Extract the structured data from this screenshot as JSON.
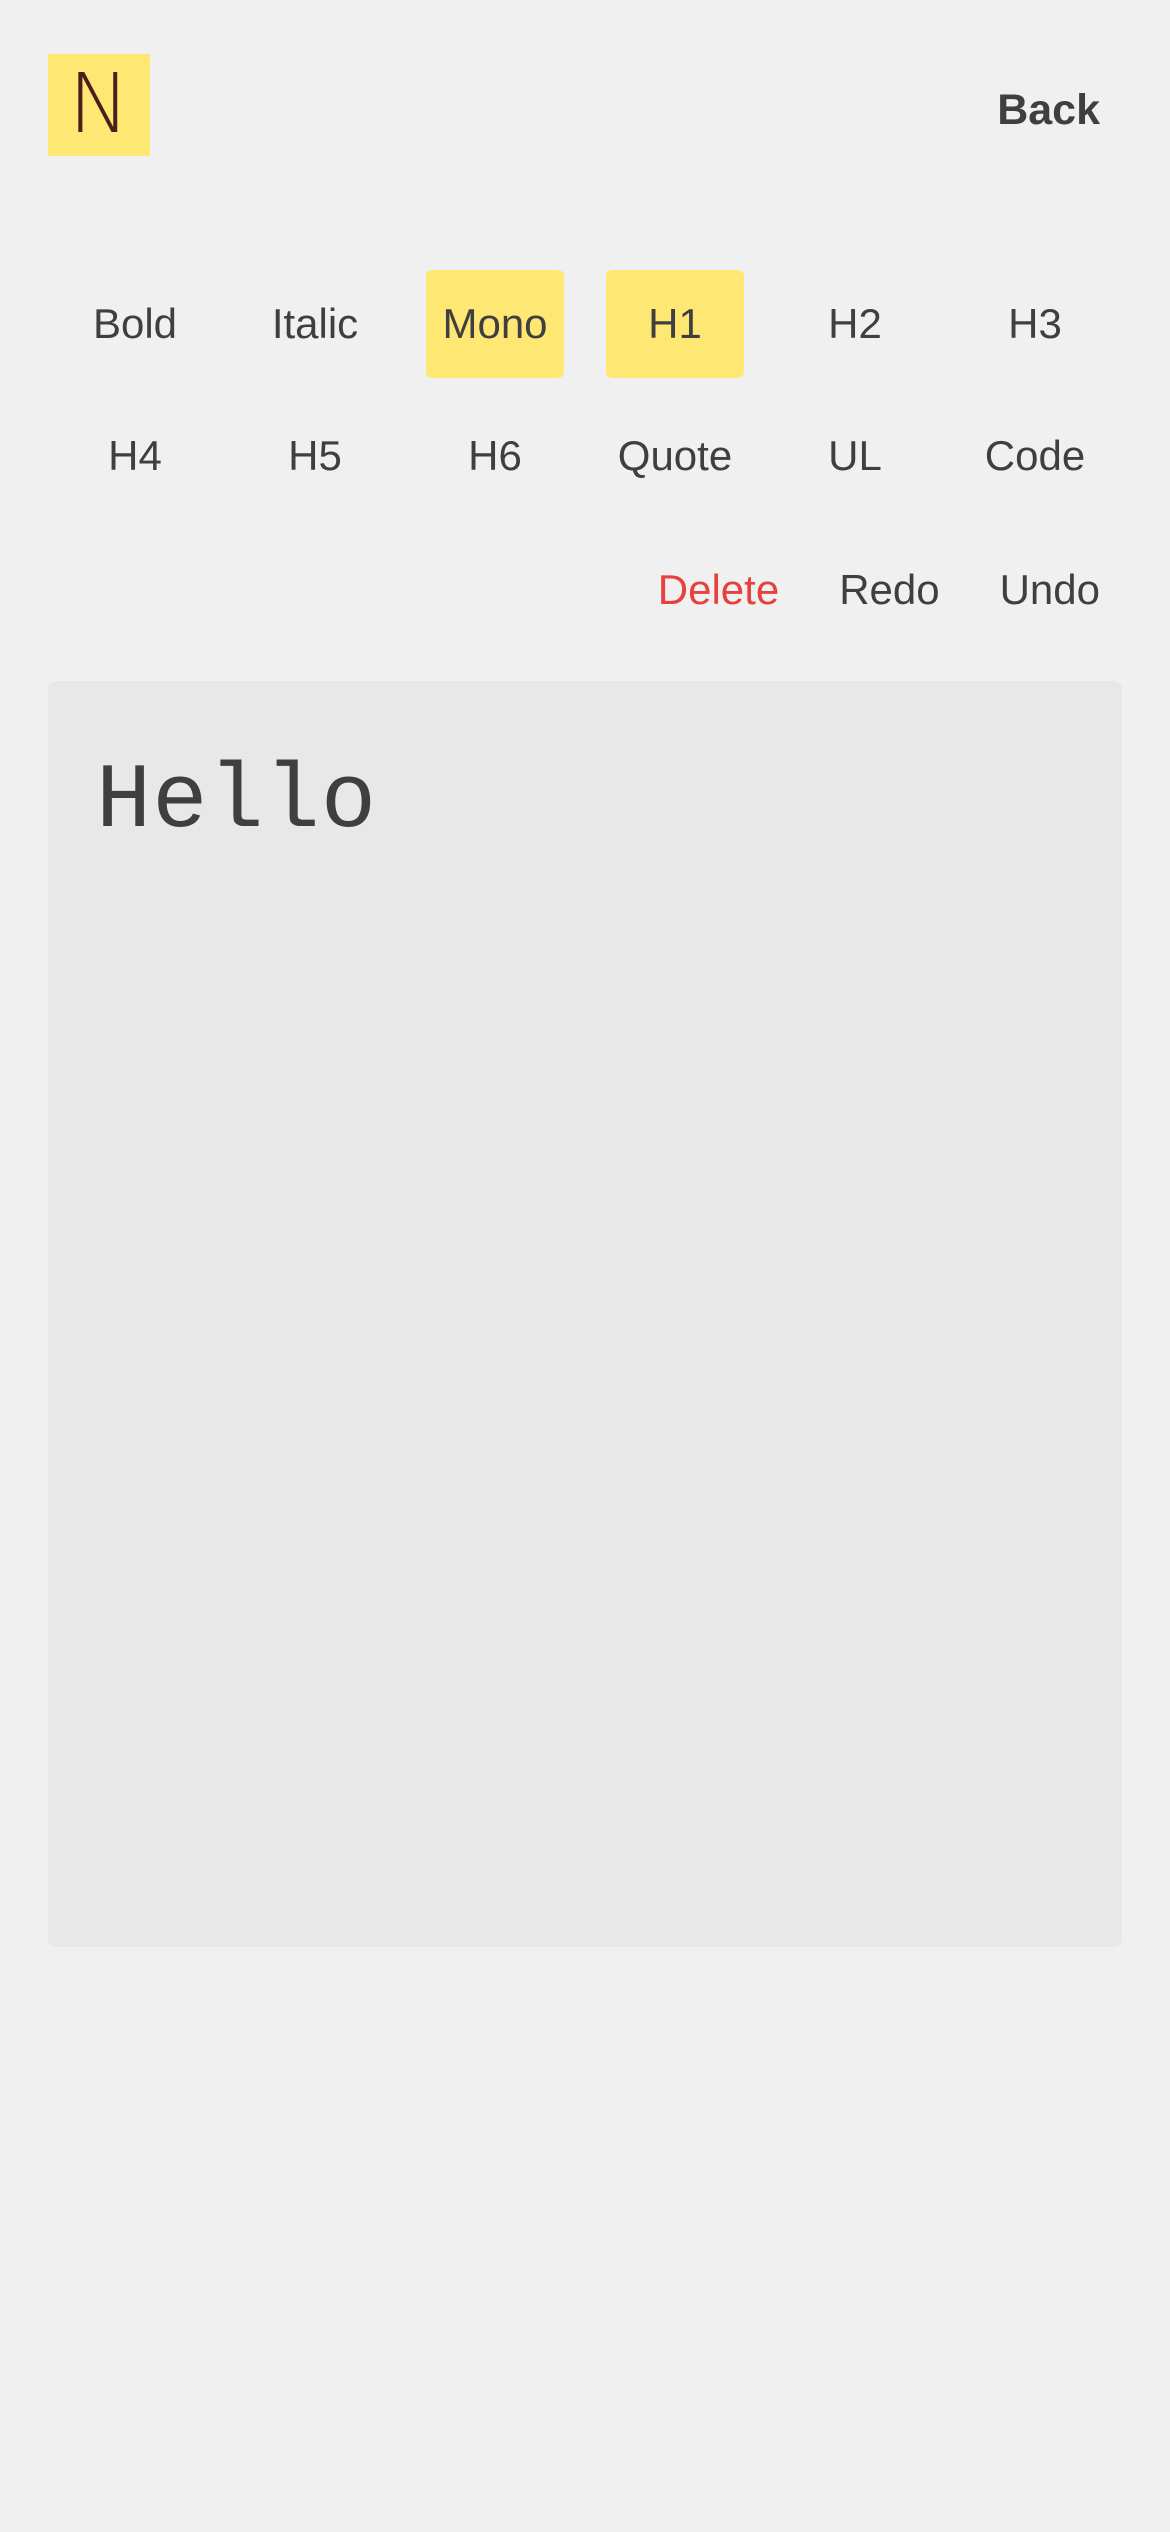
{
  "header": {
    "logo_letter": "N",
    "back_label": "Back"
  },
  "toolbar": {
    "rows": [
      [
        {
          "label": "Bold",
          "active": false
        },
        {
          "label": "Italic",
          "active": false
        },
        {
          "label": "Mono",
          "active": true
        },
        {
          "label": "H1",
          "active": true
        },
        {
          "label": "H2",
          "active": false
        },
        {
          "label": "H3",
          "active": false
        }
      ],
      [
        {
          "label": "H4",
          "active": false
        },
        {
          "label": "H5",
          "active": false
        },
        {
          "label": "H6",
          "active": false
        },
        {
          "label": "Quote",
          "active": false
        },
        {
          "label": "UL",
          "active": false
        },
        {
          "label": "Code",
          "active": false
        }
      ]
    ]
  },
  "actions": {
    "delete_label": "Delete",
    "redo_label": "Redo",
    "undo_label": "Undo"
  },
  "editor": {
    "content": "Hello"
  },
  "colors": {
    "accent": "#ffe774",
    "danger": "#e5423d",
    "background": "#f0f0f0",
    "editor_bg": "#e8e8e8",
    "text": "#3f3f3f",
    "logo_text": "#4a1f1c"
  }
}
